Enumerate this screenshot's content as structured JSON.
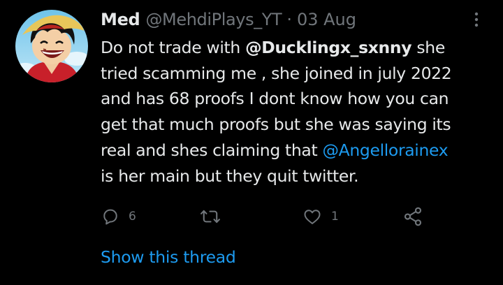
{
  "tweet": {
    "display_name": "Med",
    "handle": "@MehdiPlays_YT",
    "separator": "·",
    "date": "03 Aug",
    "body_lines": [
      {
        "pre": "Do not trade with ",
        "mention": "@Ducklingx_sxnny",
        "post": " she"
      },
      {
        "text": "tried scamming me , she joined in july 2022"
      },
      {
        "text": "and has 68 proofs I dont know how you can"
      },
      {
        "text": "get that much proofs but she was saying its"
      },
      {
        "pre": "real and shes claiming that ",
        "mention": "@Angellorainex",
        "post": ""
      },
      {
        "text": "is her main but they quit twitter."
      }
    ],
    "actions": {
      "reply_icon": "reply-icon",
      "reply_count": "6",
      "retweet_icon": "retweet-icon",
      "retweet_count": "",
      "like_icon": "heart-icon",
      "like_count": "1",
      "share_icon": "share-icon"
    },
    "show_thread": "Show this thread"
  },
  "colors": {
    "background": "#000000",
    "text": "#e7e9ea",
    "muted": "#71767b",
    "link": "#1d9bf0"
  }
}
